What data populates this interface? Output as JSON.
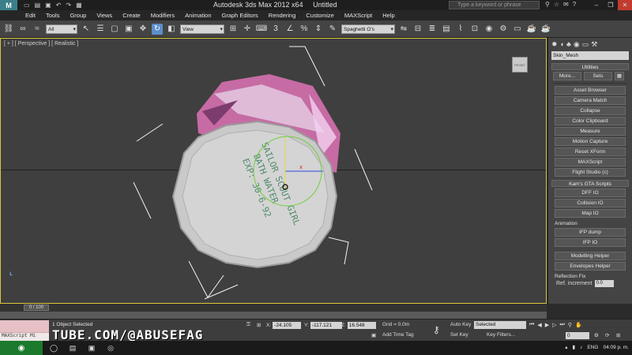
{
  "title": {
    "app": "Autodesk 3ds Max  2012 x64",
    "document": "Untitled",
    "search_placeholder": "Type a keyword or phrase"
  },
  "menu": [
    "Edit",
    "Tools",
    "Group",
    "Views",
    "Create",
    "Modifiers",
    "Animation",
    "Graph Editors",
    "Rendering",
    "Customize",
    "MAXScript",
    "Help"
  ],
  "toolbar": {
    "filter": "All",
    "coord_system": "View",
    "named_selection": "Spaghetti O's",
    "snap_label": "3"
  },
  "viewport": {
    "label": "[ + ] [ Perspective ] [ Realistic ]",
    "object_text": [
      "SAILOR SCOUT GIRL",
      "BATH WATER",
      "EXP: 30-6-92"
    ],
    "gizmo_axis_x": "x",
    "viewcube_label": "FRONT"
  },
  "command_panel": {
    "object_name": "Skin_Mesh",
    "utilities_title": "Utilities",
    "more_button": "More...",
    "sets_button": "Sets",
    "utility_buttons": [
      "Asset Browser",
      "Camera Match",
      "Collapse",
      "Color Clipboard",
      "Measure",
      "Motion Capture",
      "Reset XForm",
      "MAXScript",
      "Flight Studio (c)"
    ],
    "gta_title": "Kam's GTA Scripts",
    "gta_buttons": [
      "DFF IO",
      "Collision IO",
      "Map IO"
    ],
    "animation_label": "Animation",
    "animation_buttons": [
      "IFP dump",
      "IFP IO"
    ],
    "helper_buttons": [
      "Modelling Helper",
      "Envelopes Helper"
    ],
    "reflection_label": "Reflection Fix",
    "ref_increment_label": "Ref. increment",
    "ref_increment_value": "0.0"
  },
  "timeline": {
    "frame_display": "0 / 100"
  },
  "status": {
    "maxscript_mini": "MAXScript Mi",
    "selection": "1 Object Selected",
    "x_label": "X:",
    "x_value": "-24.105",
    "y_label": "Y:",
    "y_value": "-117.121",
    "z_label": "Z:",
    "z_value": "16.548",
    "grid": "Grid = 0.0m",
    "add_time_tag": "Add Time Tag",
    "auto_key": "Auto Key",
    "set_key": "Set Key",
    "selected_mode": "Selected",
    "key_filters": "Key Filters...",
    "current_frame": "0",
    "watermark": "TUBE.COM/@ABUSEFAG"
  },
  "taskbar": {
    "lang": "ENG",
    "clock": "04:09 p. m."
  },
  "colors": {
    "viewport_bg": "#3f3f3f",
    "active_border": "#d8c83a",
    "gizmo_green": "#6fcf3a",
    "gizmo_blue": "#2b4be0",
    "gizmo_red": "#d03030",
    "start_green": "#1b7a2b"
  }
}
